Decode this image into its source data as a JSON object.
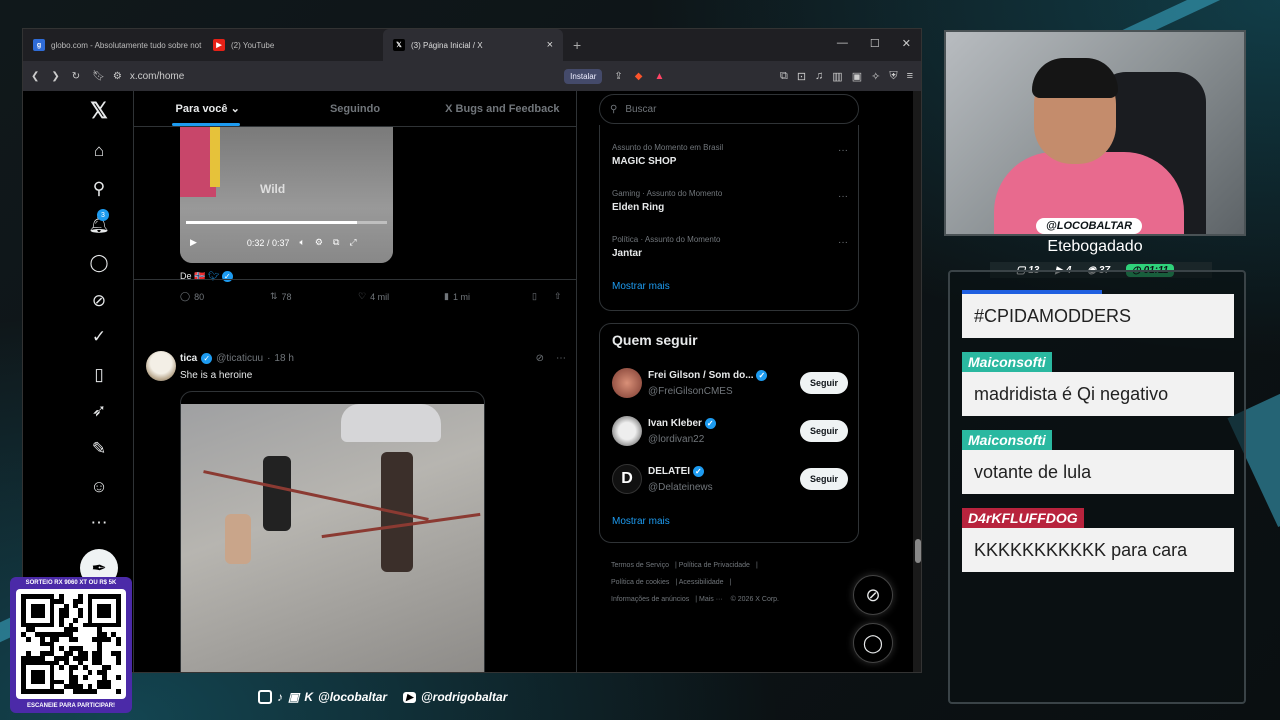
{
  "browser": {
    "tabs": [
      {
        "label": "globo.com - Absolutamente tudo sobre not",
        "icon": "globo-icon",
        "color": "#2f6cd8"
      },
      {
        "label": "(2) YouTube",
        "icon": "youtube-icon",
        "color": "#e62117"
      },
      {
        "label": "(3) Página Inicial / X",
        "icon": "x-icon",
        "color": "#ffffff",
        "active": true
      }
    ],
    "url": "x.com/home",
    "install_label": "Instalar"
  },
  "x": {
    "notification_count": "3",
    "feed_tabs": [
      "Para você",
      "Seguindo",
      "X Bugs and Feedback"
    ],
    "video1": {
      "time": "0:32 / 0:37",
      "watermark": "Wild",
      "progress": 0.85
    },
    "post1": {
      "source": "De",
      "replies": "80",
      "reposts": "78",
      "likes": "4 mil",
      "views": "1 mi"
    },
    "post2": {
      "name": "tica",
      "handle": "@ticaticuu",
      "time": "18 h",
      "text": "She is a heroine"
    },
    "search_placeholder": "Buscar",
    "trends": [
      {
        "category": "Assunto do Momento em Brasil",
        "name": "MAGIC SHOP"
      },
      {
        "category": "Gaming · Assunto do Momento",
        "name": "Elden Ring"
      },
      {
        "category": "Política · Assunto do Momento",
        "name": "Jantar"
      }
    ],
    "show_more": "Mostrar mais",
    "who_to_follow_title": "Quem seguir",
    "who_to_follow": [
      {
        "name": "Frei Gilson / Som do...",
        "handle": "@FreiGilsonCMES",
        "button": "Seguir"
      },
      {
        "name": "Ivan Kleber",
        "handle": "@lordivan22",
        "button": "Seguir"
      },
      {
        "name": "DELATEI",
        "handle": "@Delateinews",
        "button": "Seguir"
      }
    ],
    "footer_links": [
      "Termos de Serviço",
      "Política de Privacidade",
      "Política de cookies",
      "Acessibilidade",
      "Informações de anúncios",
      "Mais ···",
      "© 2026 X Corp."
    ]
  },
  "stream": {
    "handle": "@LOCOBALTAR",
    "nickname": "Etebogadado",
    "stats": {
      "chat": "13",
      "video": "4",
      "viewers": "37",
      "time": "01:11"
    },
    "chat": [
      {
        "name": "",
        "text": "#CPIDAMODDERS",
        "color": "#1f5fe0"
      },
      {
        "name": "Maiconsofti",
        "text": "madridista é Qi negativo",
        "color": "#2ab8a0"
      },
      {
        "name": "Maiconsofti",
        "text": "votante de lula",
        "color": "#2ab8a0"
      },
      {
        "name": "D4rKFLUFFDOG",
        "text": "KKKKKKKKKKK para cara",
        "color": "#b8233d"
      }
    ],
    "qr_top": "SORTEIO RX 9060 XT OU R$ 5K",
    "qr_bottom": "ESCANEIE PARA PARTICIPAR!",
    "social_1": "@locobaltar",
    "social_2": "@rodrigobaltar"
  }
}
